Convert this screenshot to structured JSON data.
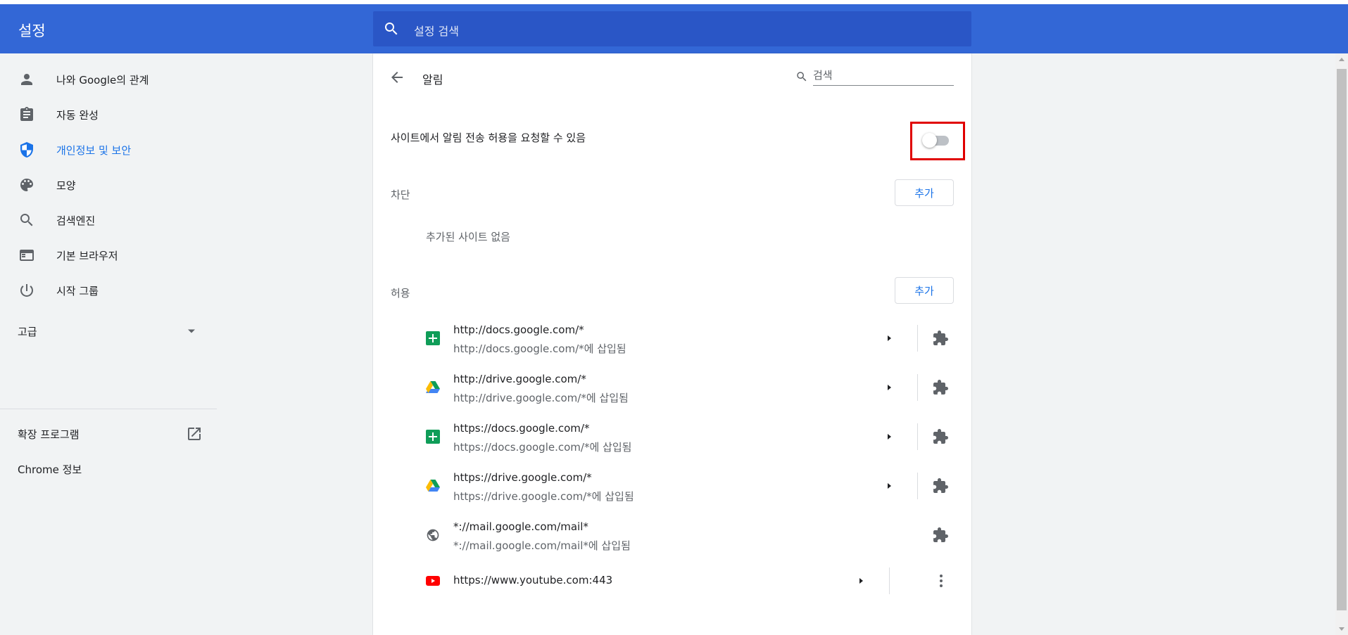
{
  "header": {
    "title": "설정",
    "search_placeholder": "설정 검색"
  },
  "sidebar": {
    "items": [
      {
        "label": "나와 Google의 관계",
        "icon": "person-icon",
        "active": false
      },
      {
        "label": "자동 완성",
        "icon": "clipboard-icon",
        "active": false
      },
      {
        "label": "개인정보 및 보안",
        "icon": "shield-icon",
        "active": true
      },
      {
        "label": "모양",
        "icon": "palette-icon",
        "active": false
      },
      {
        "label": "검색엔진",
        "icon": "search-icon",
        "active": false
      },
      {
        "label": "기본 브라우저",
        "icon": "browser-icon",
        "active": false
      },
      {
        "label": "시작 그룹",
        "icon": "power-icon",
        "active": false
      }
    ],
    "advanced_label": "고급",
    "extensions_label": "확장 프로그램",
    "about_label": "Chrome 정보"
  },
  "page": {
    "title": "알림",
    "search_placeholder": "검색",
    "toggle_label": "사이트에서 알림 전송 허용을 요청할 수 있음",
    "toggle_on": false,
    "block_title": "차단",
    "add_label": "추가",
    "block_empty": "추가된 사이트 없음",
    "allow_title": "허용"
  },
  "sites": [
    {
      "url": "http://docs.google.com/*",
      "sub": "http://docs.google.com/*에 삽입됨",
      "icon": "sheets-icon"
    },
    {
      "url": "http://drive.google.com/*",
      "sub": "http://drive.google.com/*에 삽입됨",
      "icon": "drive-icon"
    },
    {
      "url": "https://docs.google.com/*",
      "sub": "https://docs.google.com/*에 삽입됨",
      "icon": "sheets-icon"
    },
    {
      "url": "https://drive.google.com/*",
      "sub": "https://drive.google.com/*에 삽입됨",
      "icon": "drive-icon"
    },
    {
      "url": "*://mail.google.com/mail*",
      "sub": "*://mail.google.com/mail*에 삽입됨",
      "icon": "globe-icon"
    },
    {
      "url": "https://www.youtube.com:443",
      "icon": "youtube-icon"
    }
  ],
  "colors": {
    "header": "#3367d6",
    "accent": "#1a73e8",
    "highlight": "#e00000"
  }
}
